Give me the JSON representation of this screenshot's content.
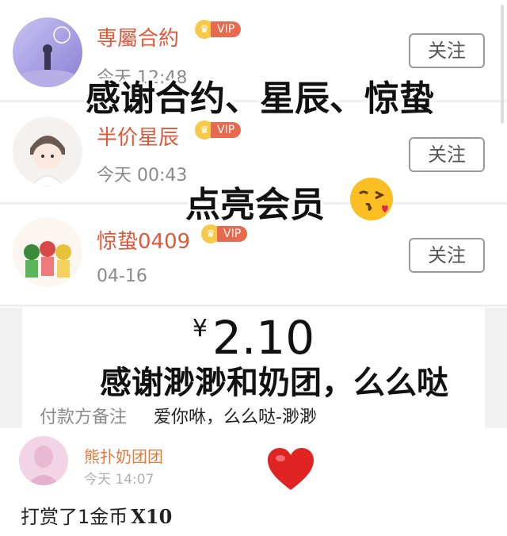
{
  "follows": [
    {
      "name": "専屬合約",
      "vip": "VIP",
      "time": "今天 12:48",
      "button": "关注"
    },
    {
      "name": "半价星辰",
      "vip": "VIP",
      "time": "今天 00:43",
      "button": "关注"
    },
    {
      "name": "惊蛰0409",
      "vip": "VIP",
      "time": "04-16",
      "button": "关注"
    }
  ],
  "overlay": {
    "thanks_members": "感谢合约、星辰、惊蛰",
    "light_member": "点亮会员",
    "thanks_payment": "感谢渺渺和奶团，么么哒",
    "tip_multiplier": "X10"
  },
  "payment": {
    "currency": "¥",
    "amount": "2.10",
    "note_label": "付款方备注",
    "note_value": "爱你咻，么么哒-渺渺"
  },
  "tip": {
    "name": "熊扑奶团团",
    "time": "今天 14:07",
    "text": "打赏了1金币"
  },
  "icons": {
    "crown": "crown-icon",
    "kiss": "kiss-emoji-icon",
    "heart": "heart-icon"
  },
  "colors": {
    "username": "#e0583b",
    "vip_tag": "#e86a4e",
    "crown": "#f7c948",
    "heart": "#e02424"
  }
}
